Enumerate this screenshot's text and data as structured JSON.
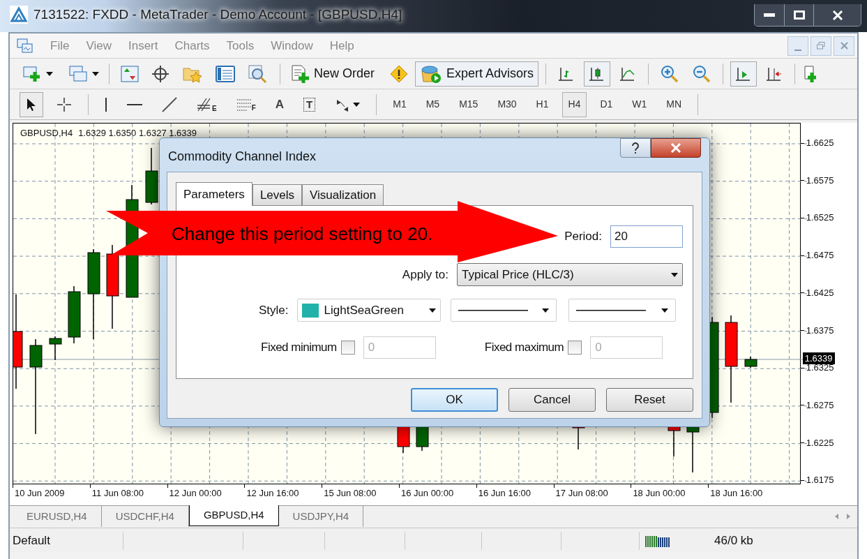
{
  "window": {
    "title": "7131522: FXDD - MetaTrader - Demo Account - [GBPUSD,H4]"
  },
  "menu": [
    "File",
    "View",
    "Insert",
    "Charts",
    "Tools",
    "Window",
    "Help"
  ],
  "toolbar": {
    "new_order": "New Order",
    "expert_advisors": {
      "label": "Expert Advisors",
      "selected": true
    }
  },
  "chart_types": [
    {
      "kind": "bars",
      "selected": false
    },
    {
      "kind": "candles",
      "selected": true
    },
    {
      "kind": "line",
      "selected": false
    }
  ],
  "scroll_tools": [
    {
      "kind": "auto_scroll",
      "selected": true
    },
    {
      "kind": "chart_shift",
      "selected": false
    }
  ],
  "drawing_tools": [
    {
      "kind": "cursor",
      "selected": true
    },
    {
      "kind": "crosshair",
      "selected": false
    },
    {
      "kind": "vline",
      "selected": false
    },
    {
      "kind": "hline",
      "selected": false
    },
    {
      "kind": "trendline",
      "selected": false
    },
    {
      "kind": "fibo_channel",
      "glyph": "E",
      "selected": false
    },
    {
      "kind": "fibo",
      "glyph": "F",
      "selected": false
    },
    {
      "kind": "text",
      "glyph": "A",
      "selected": false
    },
    {
      "kind": "label",
      "glyph": "T",
      "selected": false
    },
    {
      "kind": "arrows",
      "selected": false
    }
  ],
  "timeframes": [
    {
      "label": "M1",
      "selected": false
    },
    {
      "label": "M5",
      "selected": false
    },
    {
      "label": "M15",
      "selected": false
    },
    {
      "label": "M30",
      "selected": false
    },
    {
      "label": "H1",
      "selected": false
    },
    {
      "label": "H4",
      "selected": true
    },
    {
      "label": "D1",
      "selected": false
    },
    {
      "label": "W1",
      "selected": false
    },
    {
      "label": "MN",
      "selected": false
    }
  ],
  "chart": {
    "symbol": "GBPUSD,H4",
    "ohlc": "1.6329 1.6350 1.6327 1.6339",
    "price_labels": [
      "1.6625",
      "1.6575",
      "1.6525",
      "1.6475",
      "1.6425",
      "1.6375",
      "1.6325",
      "1.6275",
      "1.6225",
      "1.6175"
    ],
    "current_price": "1.6339",
    "time_labels": [
      "10 Jun 2009",
      "11 Jun 08:00",
      "12 Jun 00:00",
      "12 Jun 16:00",
      "15 Jun 08:00",
      "16 Jun 00:00",
      "16 Jun 16:00",
      "17 Jun 08:00",
      "18 Jun 00:00",
      "18 Jun 16:00"
    ]
  },
  "symbol_tabs": [
    {
      "label": "EURUSD,H4",
      "selected": false
    },
    {
      "label": "USDCHF,H4",
      "selected": false
    },
    {
      "label": "GBPUSD,H4",
      "selected": true
    },
    {
      "label": "USDJPY,H4",
      "selected": false
    }
  ],
  "status_bar": {
    "profile": "Default",
    "traffic": "46/0 kb"
  },
  "dialog": {
    "title": "Commodity Channel Index",
    "tabs": [
      {
        "label": "Parameters",
        "selected": true
      },
      {
        "label": "Levels",
        "selected": false
      },
      {
        "label": "Visualization",
        "selected": false
      }
    ],
    "period": {
      "label": "Period:",
      "value": "20"
    },
    "apply_to": {
      "label": "Apply to:",
      "value": "Typical Price (HLC/3)"
    },
    "style": {
      "label": "Style:",
      "color_name": "LightSeaGreen",
      "color": "#20b2aa"
    },
    "fixed_minimum": {
      "label": "Fixed minimum",
      "checked": false,
      "value": "0",
      "disabled": true
    },
    "fixed_maximum": {
      "label": "Fixed maximum",
      "checked": false,
      "value": "0",
      "disabled": true
    },
    "buttons": [
      {
        "label": "OK",
        "default": true
      },
      {
        "label": "Cancel",
        "default": false
      },
      {
        "label": "Reset",
        "default": false
      }
    ]
  },
  "annotation": {
    "text": "Change this period setting to 20."
  }
}
